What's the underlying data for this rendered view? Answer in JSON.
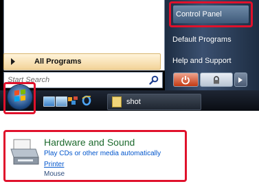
{
  "start_menu": {
    "all_programs_label": "All Programs",
    "search_placeholder": "Start Search"
  },
  "right_pane": {
    "items": [
      "Control Panel",
      "Default Programs",
      "Help and Support"
    ]
  },
  "taskbar": {
    "task_label": "shot"
  },
  "control_panel_category": {
    "title": "Hardware and Sound",
    "links": [
      "Play CDs or other media automatically",
      "Printer"
    ],
    "sub": "Mouse"
  },
  "colors": {
    "highlight": "#e0112b",
    "category_title": "#1e6a2e",
    "link": "#0055cc"
  }
}
